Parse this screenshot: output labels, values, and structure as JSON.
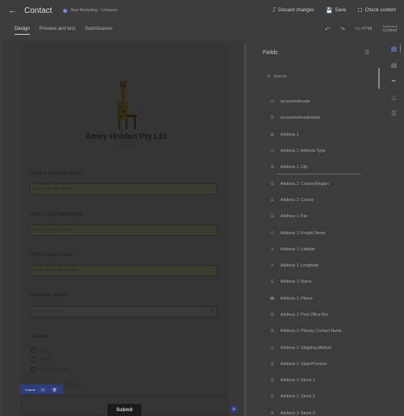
{
  "header": {
    "back_icon": "arrow-left-icon",
    "title": "Contact",
    "status": "New Marketing - Unsaved",
    "actions": [
      {
        "label": "Discard changes",
        "icon": "discard-icon"
      },
      {
        "label": "Save",
        "icon": "save-icon"
      },
      {
        "label": "Check content",
        "icon": "check-content-icon"
      }
    ]
  },
  "tabs": {
    "items": [
      "Design",
      "Preview and test",
      "Submissions"
    ],
    "active": "Design",
    "html_label": "HTML",
    "editor_label_top": "Fullscreen",
    "editor_label": "Content"
  },
  "form": {
    "org_name": "Amey Holden Pty Ltd",
    "tagline": "Nothing but love",
    "q_first": "What is your first name?",
    "ph_first": "Enter your first name",
    "q_last": "What is your last name?",
    "ph_last": "Enter your last name",
    "q_email": "What is your email?",
    "ph_email": "Enter your email address",
    "q_company": "Company Name",
    "required_mark": "*",
    "ph_company": "Company Name",
    "q_gender": "Gender",
    "gender_options": [
      "Male",
      "Female",
      "Prefer not to say"
    ],
    "consent_label": "Marketing",
    "submit_tag": "Submit",
    "submit_button": "Submit"
  },
  "fields_panel": {
    "title": "Fields",
    "search_placeholder": "Search",
    "items": [
      {
        "label": "accountrolecode",
        "icon": "choice-icon"
      },
      {
        "label": "accountrolecodename",
        "icon": "text-icon"
      },
      {
        "label": "Address 1",
        "icon": "address-icon"
      },
      {
        "label": "Address 1: Address Type",
        "icon": "choice-icon"
      },
      {
        "label": "Address 1: City",
        "icon": "text-icon"
      },
      {
        "label": "Address 1: Country/Region",
        "icon": "text-icon"
      },
      {
        "label": "Address 1: County",
        "icon": "text-icon"
      },
      {
        "label": "Address 1: Fax",
        "icon": "text-icon"
      },
      {
        "label": "Address 1: Freight Terms",
        "icon": "choice-icon"
      },
      {
        "label": "Address 1: Latitude",
        "icon": "number-icon"
      },
      {
        "label": "Address 1: Longitude",
        "icon": "number-icon"
      },
      {
        "label": "Address 1: Name",
        "icon": "text-icon"
      },
      {
        "label": "Address 1: Phone",
        "icon": "phone-icon"
      },
      {
        "label": "Address 1: Post Office Box",
        "icon": "text-icon"
      },
      {
        "label": "Address 1: Primary Contact Name",
        "icon": "text-icon"
      },
      {
        "label": "Address 1: Shipping Method",
        "icon": "choice-icon"
      },
      {
        "label": "Address 1: State/Province",
        "icon": "text-icon"
      },
      {
        "label": "Address 1: Street 1",
        "icon": "text-icon"
      },
      {
        "label": "Address 1: Street 2",
        "icon": "text-icon"
      },
      {
        "label": "Address 1: Street 3",
        "icon": "text-icon"
      }
    ]
  },
  "rail": [
    "add-element-icon",
    "fields-icon",
    "theme-icon",
    "styles-icon",
    "settings-icon"
  ]
}
